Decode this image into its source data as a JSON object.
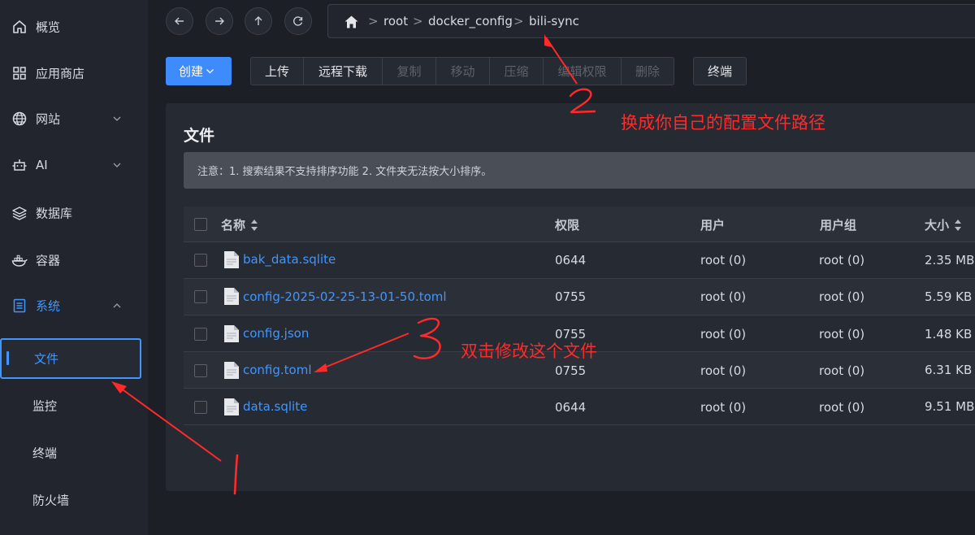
{
  "sidebar": {
    "items": [
      {
        "label": "概览",
        "icon": "home-icon"
      },
      {
        "label": "应用商店",
        "icon": "app-grid-icon"
      },
      {
        "label": "网站",
        "icon": "globe-icon"
      },
      {
        "label": "AI",
        "icon": "robot-icon"
      },
      {
        "label": "数据库",
        "icon": "layers-icon"
      },
      {
        "label": "容器",
        "icon": "docker-icon"
      },
      {
        "label": "系统",
        "icon": "system-icon"
      }
    ],
    "sub_items": [
      "文件",
      "监控",
      "终端",
      "防火墙"
    ]
  },
  "breadcrumb": {
    "items": [
      "root",
      "docker_config",
      "bili-sync"
    ],
    "separator": ">"
  },
  "toolbar": {
    "create": "创建",
    "buttons": [
      {
        "label": "上传",
        "enabled": true
      },
      {
        "label": "远程下载",
        "enabled": true
      },
      {
        "label": "复制",
        "enabled": false
      },
      {
        "label": "移动",
        "enabled": false
      },
      {
        "label": "压缩",
        "enabled": false
      },
      {
        "label": "编辑权限",
        "enabled": false
      },
      {
        "label": "删除",
        "enabled": false
      }
    ],
    "terminal": "终端"
  },
  "files": {
    "title": "文件",
    "notice": "注意：1. 搜索结果不支持排序功能 2. 文件夹无法按大小排序。",
    "columns": {
      "name": "名称",
      "permission": "权限",
      "user": "用户",
      "group": "用户组",
      "size": "大小"
    },
    "rows": [
      {
        "name": "bak_data.sqlite",
        "permission": "0644",
        "user": "root (0)",
        "group": "root (0)",
        "size": "2.35 MB"
      },
      {
        "name": "config-2025-02-25-13-01-50.toml",
        "permission": "0755",
        "user": "root (0)",
        "group": "root (0)",
        "size": "5.59 KB"
      },
      {
        "name": "config.json",
        "permission": "0755",
        "user": "root (0)",
        "group": "root (0)",
        "size": "1.48 KB"
      },
      {
        "name": "config.toml",
        "permission": "0755",
        "user": "root (0)",
        "group": "root (0)",
        "size": "6.31 KB"
      },
      {
        "name": "data.sqlite",
        "permission": "0644",
        "user": "root (0)",
        "group": "root (0)",
        "size": "9.51 MB"
      }
    ]
  },
  "annotations": {
    "note2": "换成你自己的配置文件路径",
    "note3": "双击修改这个文件",
    "color": "#ff2a2a"
  },
  "theme": {
    "accent": "#4096ff",
    "bg": "#1c1f26"
  }
}
